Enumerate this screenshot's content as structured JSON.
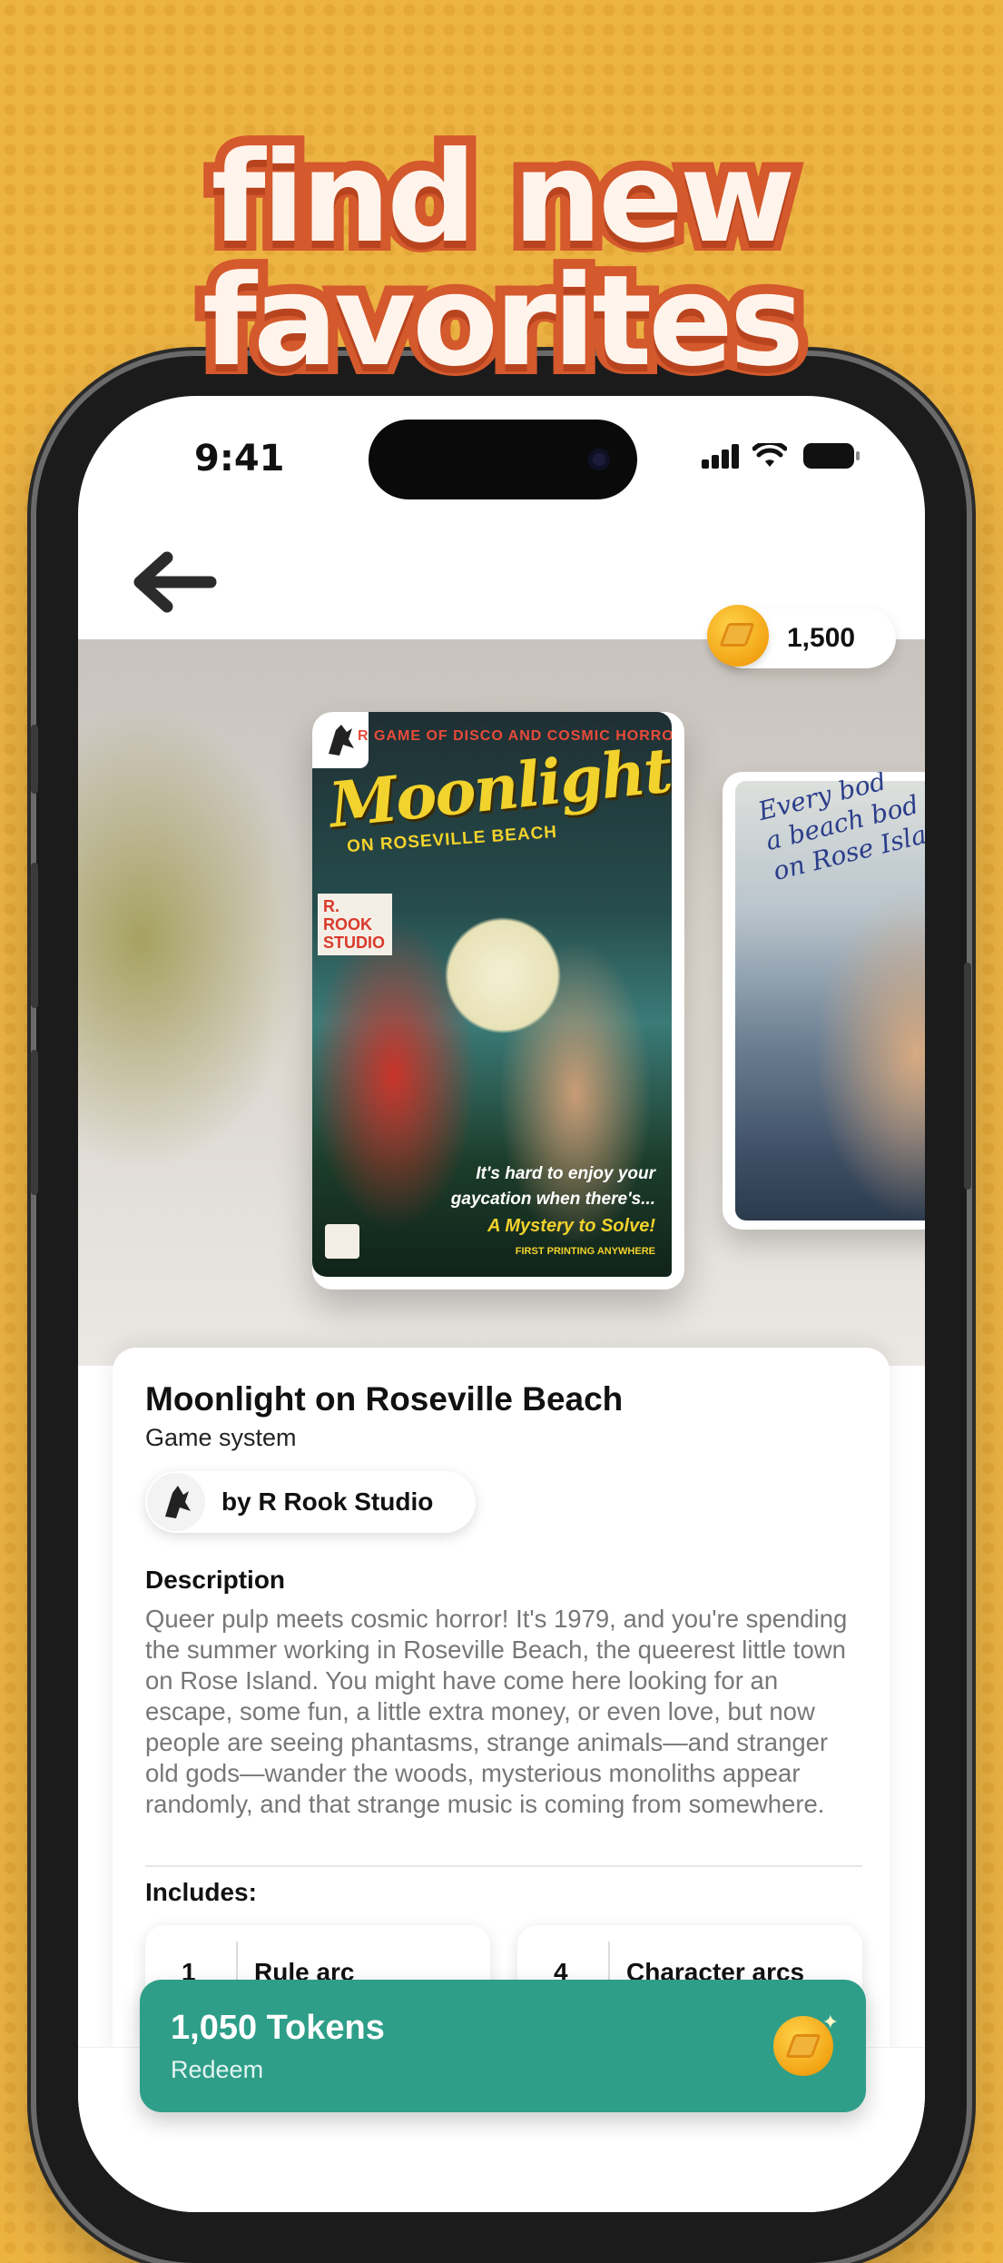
{
  "promo": {
    "line1": "find new",
    "line2": "favorites"
  },
  "status_bar": {
    "time": "9:41"
  },
  "nav": {
    "back_icon": "arrow-left-icon"
  },
  "wallet": {
    "balance": "1,500",
    "icon": "coin-icon"
  },
  "product": {
    "title": "Moonlight on Roseville Beach",
    "type": "Game system",
    "studio": "by R Rook Studio",
    "description_heading": "Description",
    "description": "Queer pulp meets cosmic horror! It's 1979, and you're spending the summer working in Roseville Beach, the queerest little town on Rose Island. You might have come here looking for an escape, some fun, a little extra money, or even love, but now people are seeing phantasms, strange animals—and stranger old gods—wander the woods, mysterious monoliths appear randomly, and that strange music is coming from somewhere.",
    "includes_heading": "Includes:",
    "includes": [
      {
        "count": "1",
        "label": "Rule arc"
      },
      {
        "count": "4",
        "label": "Character arcs"
      }
    ]
  },
  "cover_main": {
    "topline": "R GAME OF DISCO AND COSMIC HORROR",
    "title": "Moonlight",
    "subtitle": "ON ROSEVILLE BEACH",
    "studio": "R. ROOK STUDIO",
    "tag1": "It's hard to enjoy your",
    "tag2": "gaycation when there's...",
    "tag3": "A Mystery to Solve!",
    "tag4": "FIRST PRINTING ANYWHERE"
  },
  "cover_second": {
    "text": "Every bod\na beach bod\non Rose Island!"
  },
  "redeem": {
    "amount": "1,050 Tokens",
    "label": "Redeem"
  },
  "colors": {
    "accent": "#2e9e89",
    "background": "#ecb343",
    "headline_stroke": "#d4592c"
  }
}
